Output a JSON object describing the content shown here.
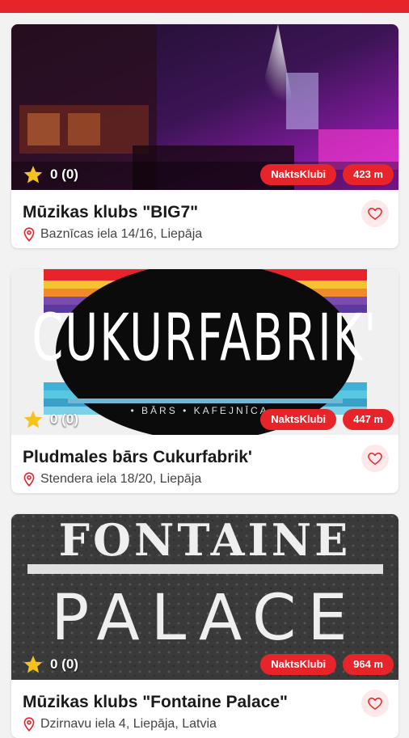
{
  "header": {
    "accent_color": "#e8242b"
  },
  "venues": [
    {
      "title": "Mūzikas klubs \"BIG7\"",
      "address": "Baznīcas iela 14/16, Liepāja",
      "rating": "0 (0)",
      "category": "NaktsKlubi",
      "distance": "423 m"
    },
    {
      "title": "Pludmales bārs Cukurfabrik'",
      "address": "Stendera iela 18/20, Liepāja",
      "rating": "0 (0)",
      "category": "NaktsKlubi",
      "distance": "447 m",
      "logo_text": "CUKURFABRIK'",
      "logo_subtext": "• BĀRS • KAFEJNĪCA •"
    },
    {
      "title": "Mūzikas klubs \"Fontaine Palace\"",
      "address": "Dzirnavu iela 4, Liepāja, Latvia",
      "rating": "0 (0)",
      "category": "NaktsKlubi",
      "distance": "964 m",
      "logo_line1": "FONTAINE",
      "logo_line2": "PALACE"
    }
  ],
  "icons": {
    "star": "star-icon",
    "location": "location-pin-icon",
    "favorite": "heart-outline-icon"
  }
}
